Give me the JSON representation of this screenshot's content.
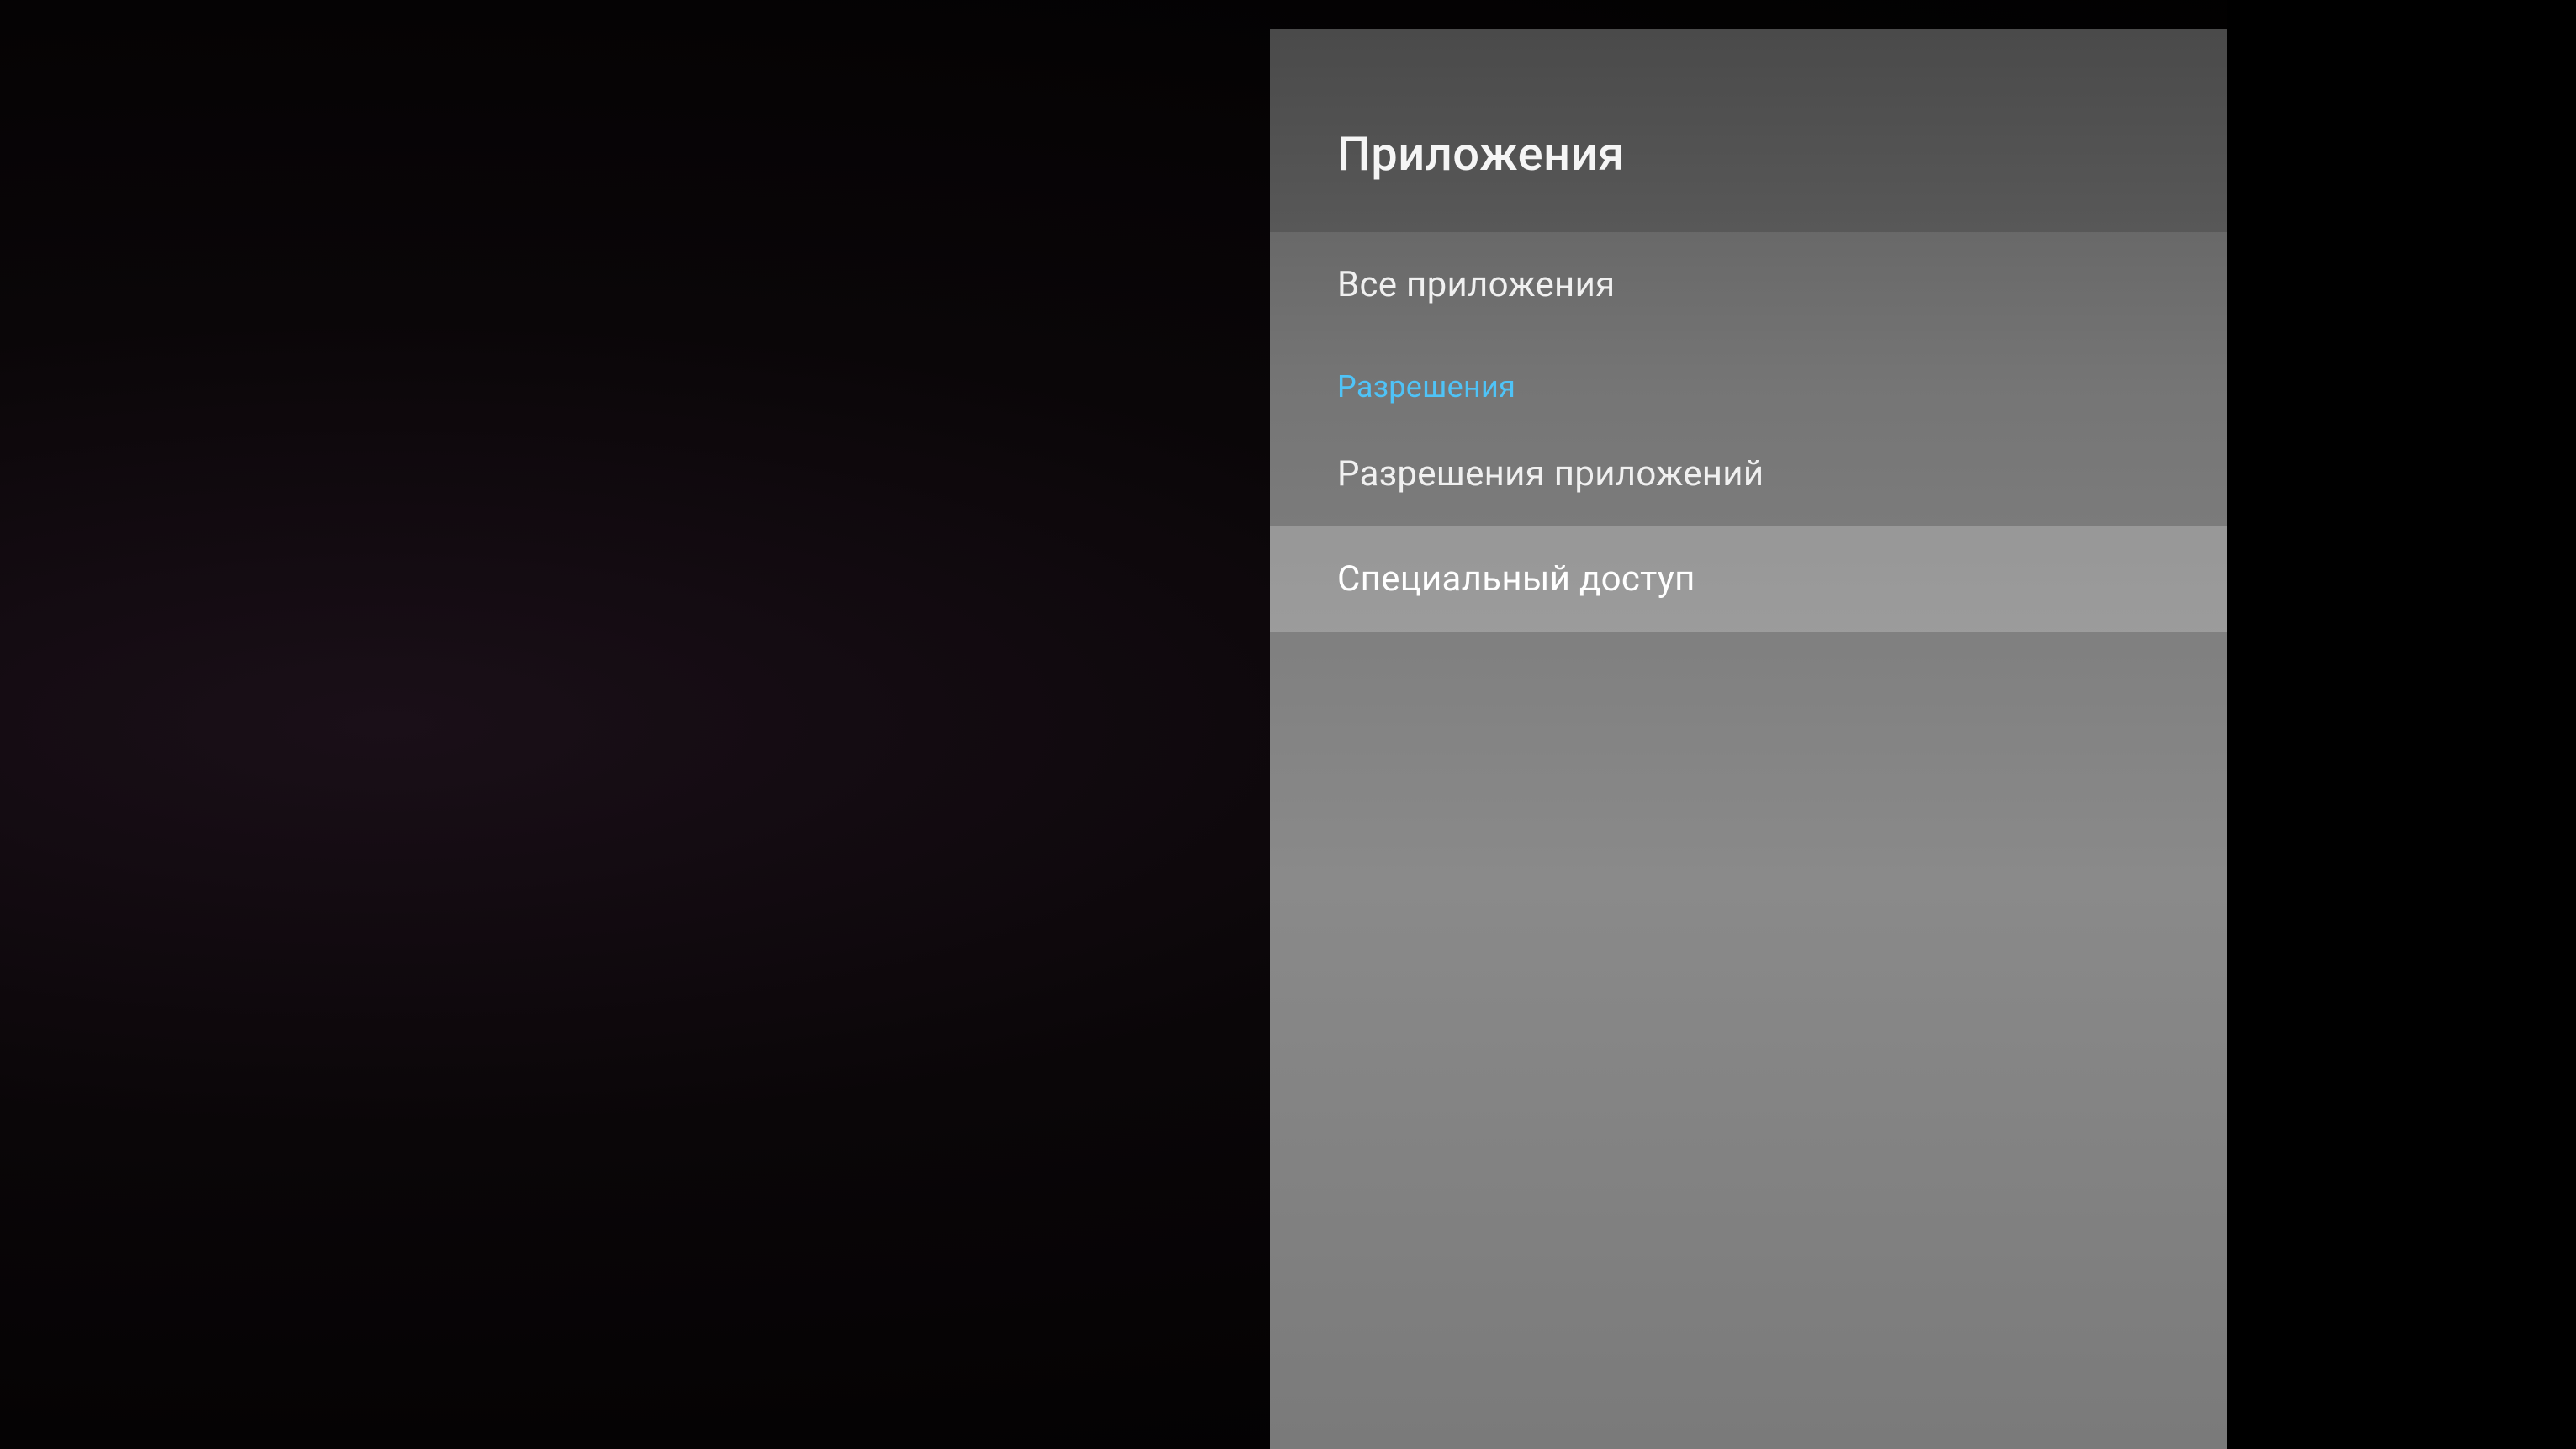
{
  "panel": {
    "title": "Приложения",
    "items": [
      {
        "label": "Все приложения",
        "type": "item",
        "selected": false
      },
      {
        "label": "Разрешения",
        "type": "section",
        "selected": false
      },
      {
        "label": "Разрешения приложений",
        "type": "item",
        "selected": false
      },
      {
        "label": "Специальный доступ",
        "type": "item",
        "selected": true
      }
    ]
  },
  "colors": {
    "accent": "#4fc3f7",
    "text_primary": "#f5f5f5",
    "panel_bg": "#707070"
  }
}
